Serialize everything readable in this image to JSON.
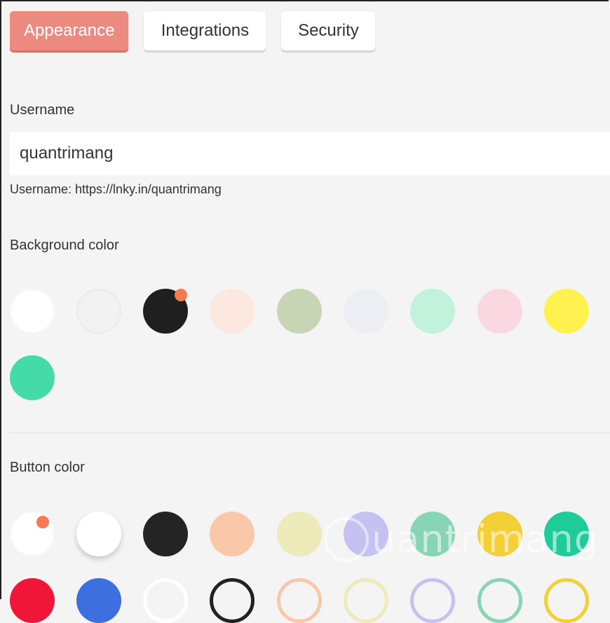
{
  "tabs": [
    {
      "label": "Appearance",
      "active": true
    },
    {
      "label": "Integrations",
      "active": false
    },
    {
      "label": "Security",
      "active": false
    }
  ],
  "username": {
    "label": "Username",
    "value": "quantrimang",
    "hint": "Username: https://lnky.in/quantrimang"
  },
  "background_color": {
    "label": "Background color",
    "swatches": [
      "#ffffff",
      "#f2f2f2",
      "#1f1f1f",
      "#fde8df",
      "#c8d5b5",
      "#eceef3",
      "#c2f2dc",
      "#fbd7e1",
      "#fff14f",
      "#45dba8"
    ],
    "selected_index": 2,
    "marker_color": "#f47a52"
  },
  "button_color": {
    "label": "Button color",
    "swatches": [
      "#ffffff",
      "#ffffff",
      "#242424",
      "#f9c8a8",
      "#ecebb9",
      "#c5c2f2",
      "#88d5b6",
      "#f3cf38",
      "#1ecc9a",
      "#f0163a",
      "#3d6fe0",
      "#ffffff",
      "#222222",
      "#f9c8a8",
      "#ecebb9",
      "#c5c2f2",
      "#88d5b6",
      "#f3cf38"
    ],
    "outline_start_index": 11,
    "selected_index": 0
  },
  "watermark": "uantrimang"
}
